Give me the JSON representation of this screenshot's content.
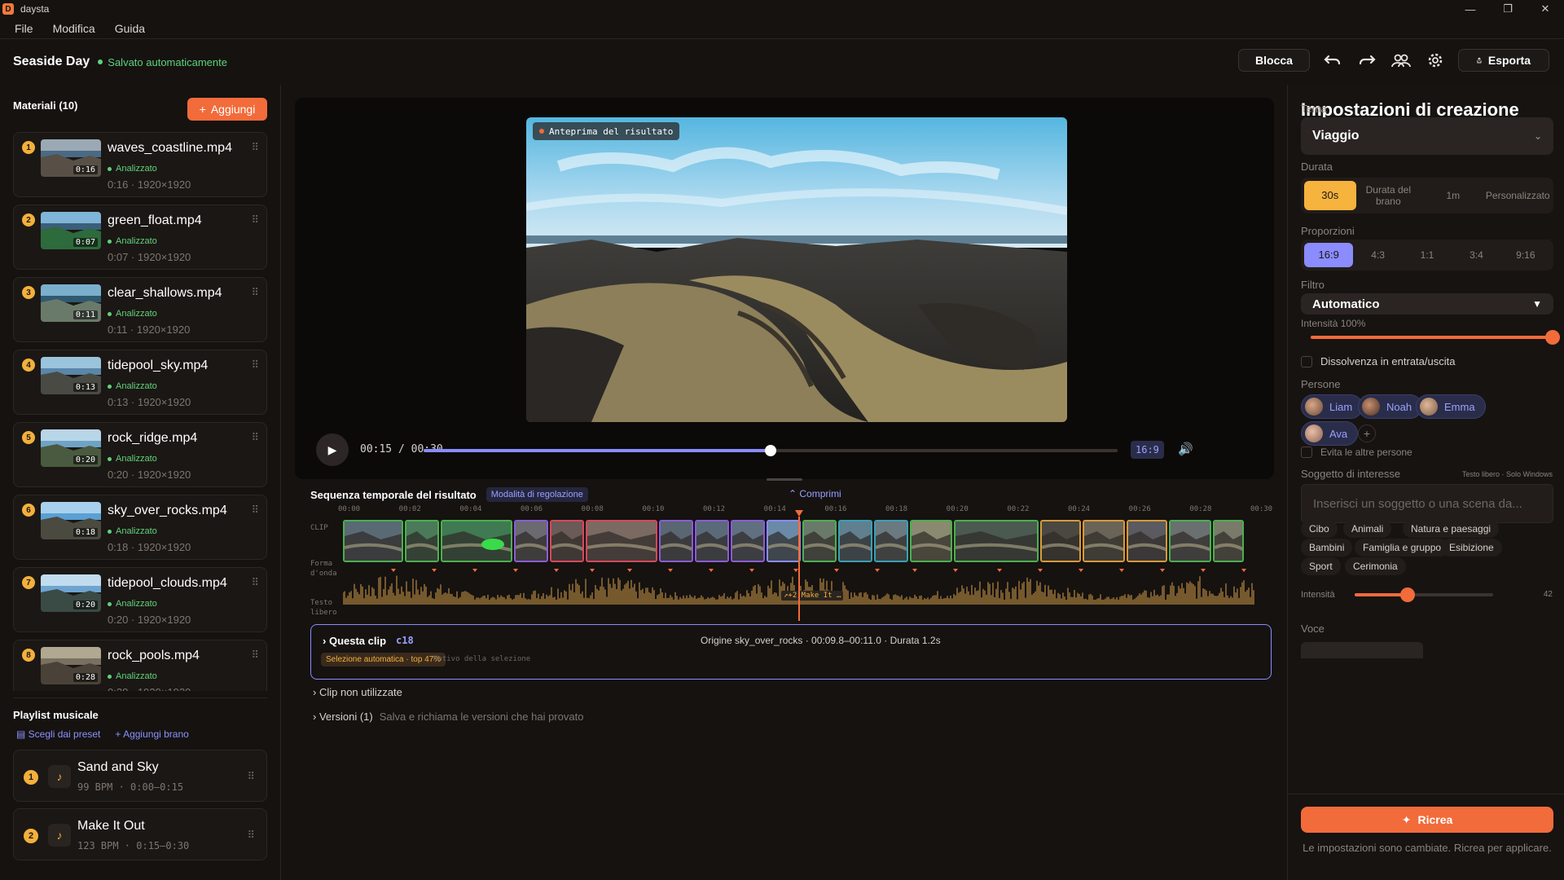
{
  "window": {
    "app_title": "daysta",
    "minimize": "—",
    "restore": "❐",
    "close": "✕"
  },
  "menu": [
    "File",
    "Modifica",
    "Guida"
  ],
  "header": {
    "project": "Seaside Day",
    "saved": "Salvato automaticamente",
    "lock": "Blocca",
    "export": "Esporta"
  },
  "materials": {
    "title": "Materiali (10)",
    "add": "Aggiungi",
    "status": "Analizzato",
    "items": [
      {
        "n": "1",
        "name": "waves_coastline.mp4",
        "dur": "0:16",
        "meta": "0:16 · 1920×1920"
      },
      {
        "n": "2",
        "name": "green_float.mp4",
        "dur": "0:07",
        "meta": "0:07 · 1920×1920"
      },
      {
        "n": "3",
        "name": "clear_shallows.mp4",
        "dur": "0:11",
        "meta": "0:11 · 1920×1920"
      },
      {
        "n": "4",
        "name": "tidepool_sky.mp4",
        "dur": "0:13",
        "meta": "0:13 · 1920×1920"
      },
      {
        "n": "5",
        "name": "rock_ridge.mp4",
        "dur": "0:20",
        "meta": "0:20 · 1920×1920"
      },
      {
        "n": "6",
        "name": "sky_over_rocks.mp4",
        "dur": "0:18",
        "meta": "0:18 · 1920×1920"
      },
      {
        "n": "7",
        "name": "tidepool_clouds.mp4",
        "dur": "0:20",
        "meta": "0:20 · 1920×1920"
      },
      {
        "n": "8",
        "name": "rock_pools.mp4",
        "dur": "0:28",
        "meta": "0:28 · 1920×1920"
      }
    ]
  },
  "playlist": {
    "title": "Playlist musicale",
    "preset": "Scegli dai preset",
    "add_track": "Aggiungi brano",
    "tracks": [
      {
        "n": "1",
        "name": "Sand and Sky",
        "meta": "99 BPM · 0:00–0:15"
      },
      {
        "n": "2",
        "name": "Make It Out",
        "meta": "123 BPM · 0:15–0:30"
      }
    ]
  },
  "player": {
    "badge": "Anteprima del risultato",
    "time": "00:15 / 00:30",
    "progress": 0.5,
    "ratio": "16:9"
  },
  "timeline": {
    "title": "Sequenza temporale del risultato",
    "mode": "Modalità di regolazione",
    "collapse": "Comprimi",
    "row_clip": "CLIP",
    "row_wave": "Forma d'onda",
    "row_text": "Testo libero",
    "ticks": [
      "00:00",
      "00:02",
      "00:04",
      "00:06",
      "00:08",
      "00:10",
      "00:12",
      "00:14",
      "00:16",
      "00:18",
      "00:20",
      "00:22",
      "00:24",
      "00:26",
      "00:28",
      "00:30"
    ],
    "marker": "↗+2 Make It …",
    "playhead": 0.5
  },
  "this_clip": {
    "title": "Questa clip",
    "id": "c18",
    "origin": "Origine sky_over_rocks · 00:09.8–00:11.0 · Durata 1.2s",
    "selection": "Selezione automatica · top 47%",
    "reason": "Motivo della selezione"
  },
  "unused": "Clip non utilizzate",
  "versions": {
    "label": "Versioni (1)",
    "desc": "Salva e richiama le versioni che hai provato"
  },
  "settings": {
    "title": "Impostazioni di creazione",
    "theme_label": "Tema",
    "theme": "Viaggio",
    "duration_label": "Durata",
    "durations": [
      "30s",
      "Durata del brano",
      "1m",
      "Personalizzato"
    ],
    "ratio_label": "Proporzioni",
    "ratios": [
      "16:9",
      "4:3",
      "1:1",
      "3:4",
      "9:16"
    ],
    "filter_label": "Filtro",
    "filter": "Automatico",
    "intensity": "Intensità 100%",
    "filter_intensity": 1.0,
    "fade": "Dissolvenza in entrata/uscita",
    "people_label": "Persone",
    "people": [
      "Liam",
      "Noah",
      "Emma",
      "Ava"
    ],
    "avoid": "Evita le altre persone",
    "subject_label": "Soggetto di interesse",
    "subject_hint": "Testo libero · Solo Windows",
    "subject_placeholder": "Inserisci un soggetto o una scena da...",
    "chips": [
      "Cibo",
      "Animali",
      "Natura e paesaggi",
      "Bambini",
      "Famiglia e gruppo",
      "Esibizione",
      "Sport",
      "Cerimonia"
    ],
    "intensity_label": "Intensità",
    "intensity_value": "42",
    "voice_label": "Voce",
    "recreate": "Ricrea",
    "note": "Le impostazioni sono cambiate. Ricrea per applicare."
  }
}
